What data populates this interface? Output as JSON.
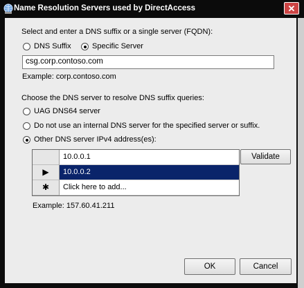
{
  "window": {
    "title": "Name Resolution Servers used by DirectAccess",
    "close_label": "✕"
  },
  "section1": {
    "label": "Select and enter a DNS suffix or a single server (FQDN):",
    "radio_dns_suffix": "DNS Suffix",
    "radio_specific_server": "Specific Server",
    "selected": "Specific Server",
    "server_value": "csg.corp.contoso.com",
    "example": "Example: corp.contoso.com"
  },
  "section2": {
    "label": "Choose the DNS server to resolve DNS suffix queries:",
    "option_uag": "UAG DNS64 server",
    "option_none": "Do not use an internal DNS server for the specified server or suffix.",
    "option_other": "Other DNS server IPv4 address(es):",
    "selected": "Other DNS server IPv4 address(es):"
  },
  "grid": {
    "rows": [
      {
        "marker": "",
        "value": "10.0.0.1"
      },
      {
        "marker": "▶",
        "value": "10.0.0.2"
      },
      {
        "marker": "✱",
        "value": "Click here to add..."
      }
    ],
    "selected_row": 1,
    "example": "Example: 157.60.41.211"
  },
  "buttons": {
    "validate": "Validate",
    "ok": "OK",
    "cancel": "Cancel"
  }
}
